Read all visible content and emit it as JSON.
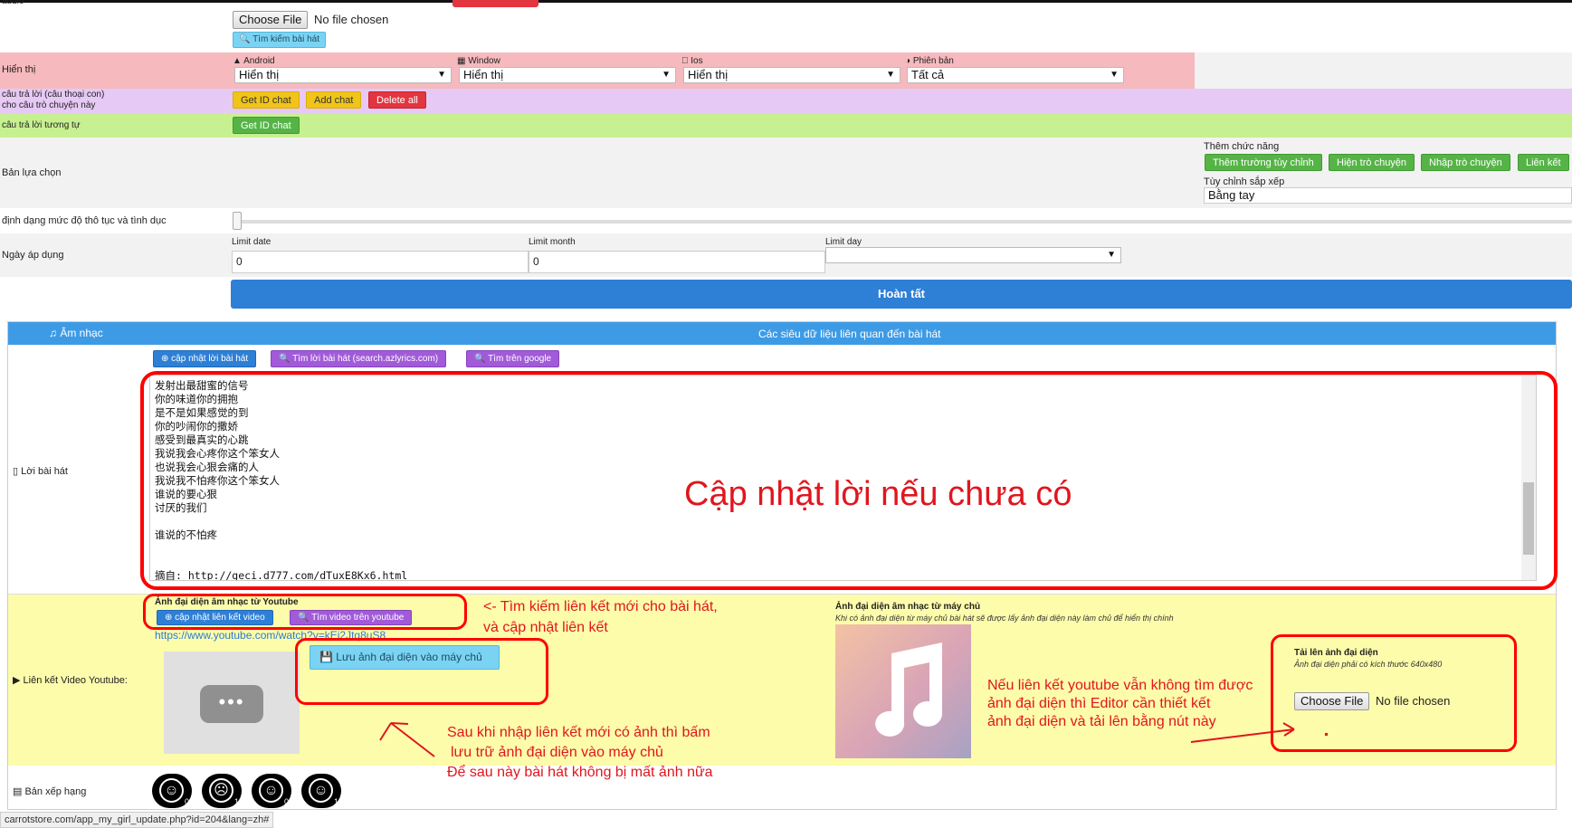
{
  "top": {
    "audio_label": "audio",
    "choose_file": "Choose File",
    "no_file": "No file chosen",
    "search_song": "Tìm kiếm bài hát"
  },
  "display": {
    "label": "Hiển thị",
    "platforms": [
      {
        "name": "Android",
        "value": "Hiển thị"
      },
      {
        "name": "Window",
        "value": "Hiển thị"
      },
      {
        "name": "Ios",
        "value": "Hiển thị"
      },
      {
        "name": "Phiên bản",
        "value": "Tất cả"
      }
    ]
  },
  "reply": {
    "label_line1": "câu trả lời (câu thoại con)",
    "label_line2": "cho câu trò chuyện này",
    "get_id": "Get ID chat",
    "add_chat": "Add chat",
    "delete_all": "Delete all"
  },
  "similar": {
    "label": "câu trả lời tương tự",
    "get_id": "Get ID chat"
  },
  "options": {
    "label": "Bản lựa chọn",
    "add_func": "Thêm chức năng",
    "btn_custom": "Thêm trường tùy chỉnh",
    "btn_show": "Hiện trò chuyện",
    "btn_import": "Nhập trò chuyện",
    "btn_link": "Liên kết",
    "sort_label": "Tùy chỉnh sắp xếp",
    "sort_value": "Bằng tay"
  },
  "rating_format": {
    "label": "định dạng mức độ thô tục và tình dục"
  },
  "apply": {
    "label": "Ngày áp dụng",
    "limit_date": "Limit date",
    "limit_date_val": "0",
    "limit_month": "Limit month",
    "limit_month_val": "0",
    "limit_day": "Limit day"
  },
  "finish": "Hoàn tất",
  "music": {
    "header_left": "Âm nhạc",
    "header_center": "Các siêu dữ liệu liên quan đến bài hát",
    "lyrics_label": "Lời bài hát",
    "btn_update_lyrics": "cập nhật lời bài hát",
    "btn_search_az": "Tìm lời bài hát (search.azlyrics.com)",
    "btn_search_google": "Tìm trên google",
    "lyrics_lines": [
      "发射出最甜蜜的信号",
      "你的味道你的拥抱",
      "是不是如果感觉的到",
      "你的吵闹你的撒娇",
      "感受到最真实的心跳",
      "我说我会心疼你这个笨女人",
      "也说我会心狠会痛的人",
      "我说我不怕疼你这个笨女人",
      "谁说的要心狠",
      "讨厌的我们",
      "",
      "谁说的不怕疼",
      "",
      "",
      "摘自: http://geci.d777.com/dTuxE8Kx6.html"
    ],
    "yt_label": "Liên kết Video Youtube:",
    "yt_title": "Ảnh đại diện âm nhạc từ Youtube",
    "btn_update_video": "cập nhật liên kết video",
    "btn_search_video": "Tìm video trên youtube",
    "yt_link": "https://www.youtube.com/watch?v=kEi2Jtq8uS8",
    "btn_save_thumb": "Lưu ảnh đại diện vào máy chủ",
    "server_title": "Ảnh đại diện âm nhạc từ máy chủ",
    "server_sub": "Khi có ảnh đại diện từ máy chủ bài hát sẽ được lấy ảnh đại diện này làm chủ để hiển thị chính",
    "upload_title": "Tải lên ảnh đại diện",
    "upload_sub": "Ảnh đại diện phải có kích thước 640x480",
    "choose_file": "Choose File",
    "no_file": "No file chosen",
    "rank_label": "Bản xếp hạng",
    "ranks": [
      "0",
      "1",
      "0",
      "1"
    ]
  },
  "annotations": {
    "lyrics_big": "Cập nhật lời nếu chưa có",
    "search_line1": "<- Tìm kiếm liên kết mới cho bài hát,",
    "search_line2": "và cập nhật liên kết",
    "save_line1": "Sau khi nhập liên kết mới có ảnh thì bấm",
    "save_line2": "lưu trữ ảnh đại diện vào máy chủ",
    "save_line3": "Để sau này bài hát không bị mất ảnh nữa",
    "upload_line1": "Nếu liên kết youtube vẫn không tìm được",
    "upload_line2": "ảnh đại diện thì Editor cần thiết kết",
    "upload_line3": "ảnh đại diện và tải lên bằng nút này"
  },
  "statusbar": "carrotstore.com/app_my_girl_update.php?id=204&lang=zh#"
}
